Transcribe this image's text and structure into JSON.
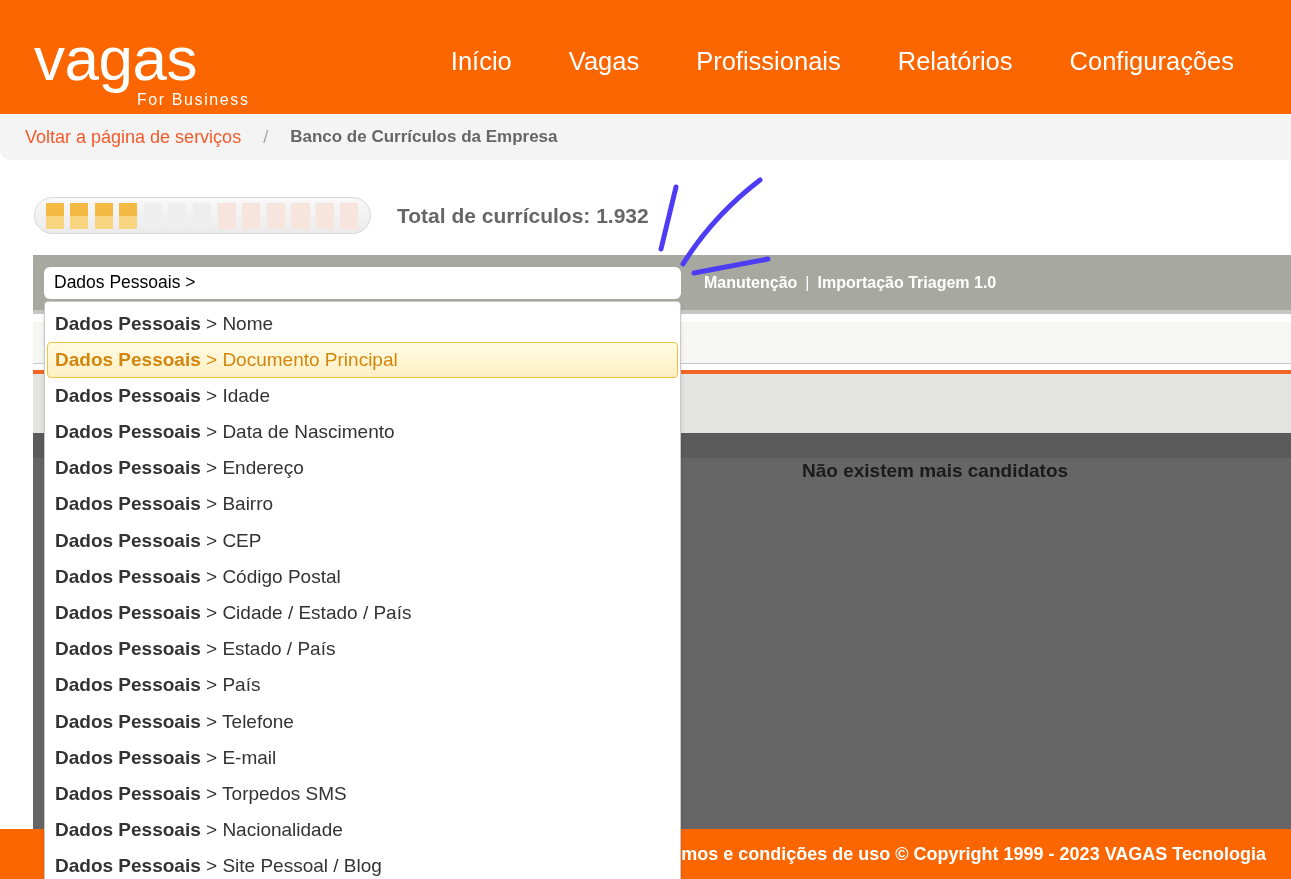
{
  "header": {
    "logo": {
      "wordmark": "vagas",
      "tagline": "For Business"
    },
    "nav": [
      {
        "label": "Início"
      },
      {
        "label": "Vagas"
      },
      {
        "label": "Profissionais"
      },
      {
        "label": "Relatórios"
      },
      {
        "label": "Configurações"
      }
    ]
  },
  "breadcrumb": {
    "items": [
      {
        "label": "Voltar a página de serviços",
        "kind": "link"
      },
      {
        "label": "Banco de Currículos da Empresa",
        "kind": "current"
      }
    ],
    "separator": "/"
  },
  "summary": {
    "meter": {
      "level": 0.31
    },
    "total": "Total de currículos: 1.932"
  },
  "toolbar": {
    "search": {
      "value": "Dados Pessoais >"
    },
    "links": [
      "Manutenção",
      "Importação Triagem 1.0"
    ],
    "separator": "|"
  },
  "suggestions": [
    {
      "label": "**Dados Pessoais** > Nome",
      "selected": false
    },
    {
      "label": "**Dados Pessoais** > Documento Principal",
      "selected": true
    },
    {
      "label": "**Dados Pessoais** > Idade",
      "selected": false
    },
    {
      "label": "**Dados Pessoais** > Data de Nascimento",
      "selected": false
    },
    {
      "label": "**Dados Pessoais** > Endereço",
      "selected": false
    },
    {
      "label": "**Dados Pessoais** > Bairro",
      "selected": false
    },
    {
      "label": "**Dados Pessoais** > CEP",
      "selected": false
    },
    {
      "label": "**Dados Pessoais** > Código Postal",
      "selected": false
    },
    {
      "label": "**Dados Pessoais** > Cidade / Estado / País",
      "selected": false
    },
    {
      "label": "**Dados Pessoais** > Estado / País",
      "selected": false
    },
    {
      "label": "**Dados Pessoais** > País",
      "selected": false
    },
    {
      "label": "**Dados Pessoais** > Telefone",
      "selected": false
    },
    {
      "label": "**Dados Pessoais** > E-mail",
      "selected": false
    },
    {
      "label": "**Dados Pessoais** > Torpedos SMS",
      "selected": false
    },
    {
      "label": "**Dados Pessoais** > Nacionalidade",
      "selected": false
    },
    {
      "label": "**Dados Pessoais** > Site Pessoal / Blog",
      "selected": false
    }
  ],
  "results": {
    "empty_message": "Não existem mais candidatos"
  },
  "footer": {
    "text": "mos e condições de uso © Copyright 1999 - 2023 VAGAS Tecnologia"
  }
}
